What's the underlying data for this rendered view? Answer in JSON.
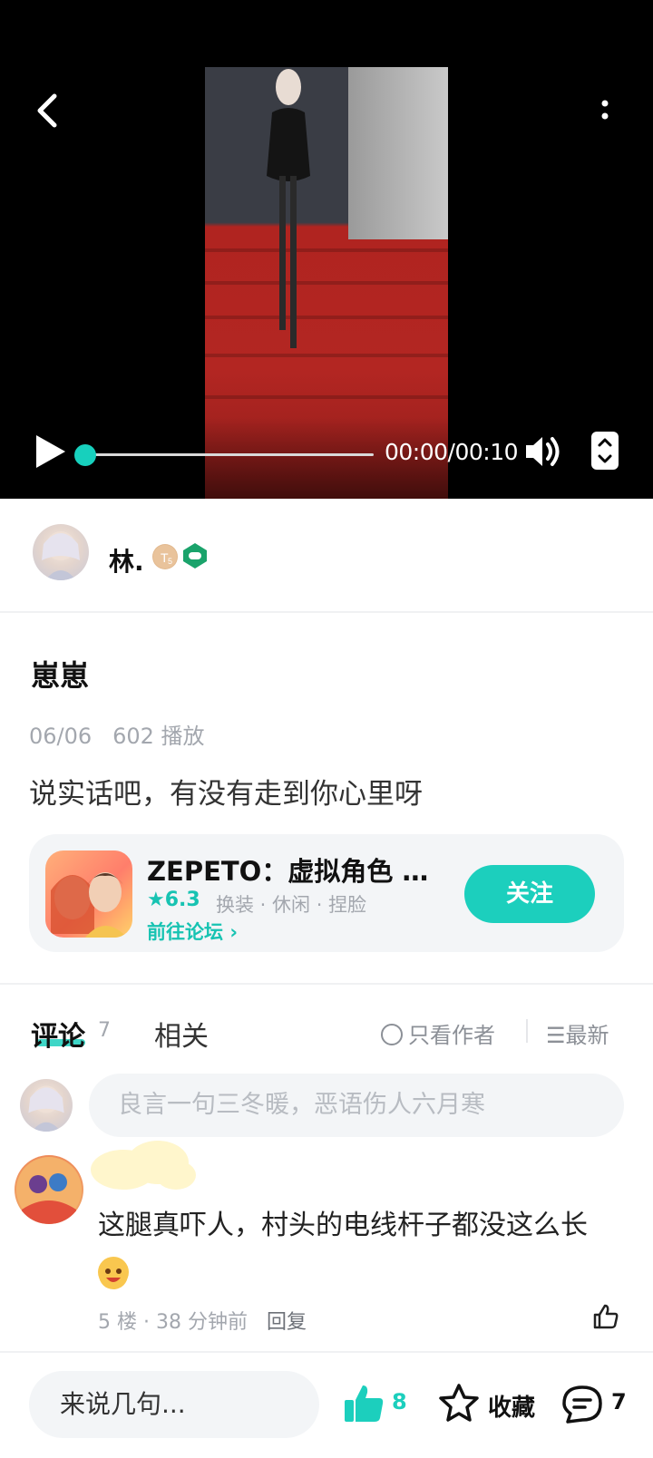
{
  "video": {
    "current_time": "00:00",
    "duration": "00:10",
    "time_display": "00:00/00:10",
    "progress": 0.0
  },
  "author": {
    "name": "林.",
    "badge_level": "T5"
  },
  "post": {
    "title": "崽崽",
    "date": "06/06",
    "plays": "602 播放",
    "body": "说实话吧，有没有走到你心里呀"
  },
  "app_card": {
    "name": "ZEPETO：虚拟角色 …",
    "rating": "6.3",
    "tags": "换装 · 休闲 · 捏脸",
    "forum_link": "前往论坛",
    "follow_label": "关注"
  },
  "tabs": {
    "comments_label": "评论",
    "comments_count": "7",
    "related_label": "相关",
    "author_only_label": "只看作者",
    "sort_label": "最新"
  },
  "comment_input": {
    "placeholder": "良言一句三冬暖，恶语伤人六月寒"
  },
  "comments": [
    {
      "text": "这腿真吓人，村头的电线杆子都没这么长",
      "floor": "5 楼",
      "time": "38 分钟前",
      "reply_label": "回复"
    }
  ],
  "bottom_bar": {
    "input_placeholder": "来说几句...",
    "like_count": "8",
    "favorite_label": "收藏",
    "comment_count": "7"
  },
  "colors": {
    "accent": "#1ccfbd",
    "muted_text": "#a3a7ae",
    "card_bg": "#f3f5f7"
  }
}
